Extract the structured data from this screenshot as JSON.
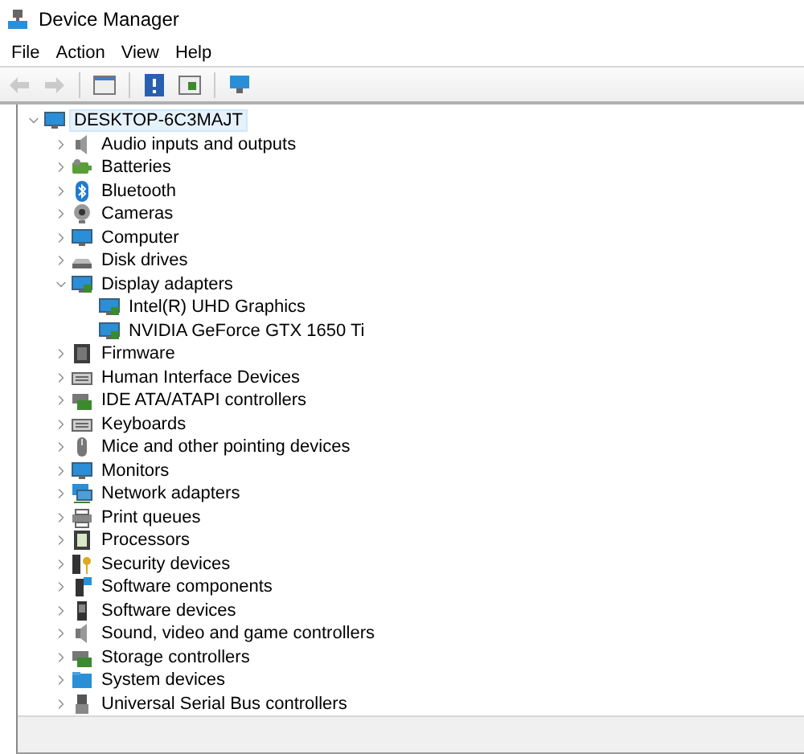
{
  "window": {
    "title": "Device Manager"
  },
  "menu": [
    {
      "label": "File"
    },
    {
      "label": "Action"
    },
    {
      "label": "View"
    },
    {
      "label": "Help"
    }
  ],
  "toolbar": [
    {
      "disabled": true
    },
    {
      "disabled": true
    },
    {
      "disabled": false
    },
    {
      "disabled": false
    },
    {
      "disabled": false
    },
    {
      "disabled": false
    }
  ],
  "tree": {
    "label": "DESKTOP-6C3MAJT",
    "expanded": true,
    "selected": true,
    "children": [
      {
        "label": "Audio inputs and outputs",
        "expanded": false,
        "selected": false
      },
      {
        "label": "Batteries",
        "expanded": false,
        "selected": false
      },
      {
        "label": "Bluetooth",
        "expanded": false,
        "selected": false
      },
      {
        "label": "Cameras",
        "expanded": false,
        "selected": false
      },
      {
        "label": "Computer",
        "expanded": false,
        "selected": false
      },
      {
        "label": "Disk drives",
        "expanded": false,
        "selected": false
      },
      {
        "label": "Display adapters",
        "expanded": true,
        "selected": false,
        "children": [
          {
            "label": "Intel(R) UHD Graphics",
            "selected": false
          },
          {
            "label": "NVIDIA GeForce GTX 1650 Ti",
            "selected": false
          }
        ]
      },
      {
        "label": "Firmware",
        "expanded": false,
        "selected": false
      },
      {
        "label": "Human Interface Devices",
        "expanded": false,
        "selected": false
      },
      {
        "label": "IDE ATA/ATAPI controllers",
        "expanded": false,
        "selected": false
      },
      {
        "label": "Keyboards",
        "expanded": false,
        "selected": false
      },
      {
        "label": "Mice and other pointing devices",
        "expanded": false,
        "selected": false
      },
      {
        "label": "Monitors",
        "expanded": false,
        "selected": false
      },
      {
        "label": "Network adapters",
        "expanded": false,
        "selected": false
      },
      {
        "label": "Print queues",
        "expanded": false,
        "selected": false
      },
      {
        "label": "Processors",
        "expanded": false,
        "selected": false
      },
      {
        "label": "Security devices",
        "expanded": false,
        "selected": false
      },
      {
        "label": "Software components",
        "expanded": false,
        "selected": false
      },
      {
        "label": "Software devices",
        "expanded": false,
        "selected": false
      },
      {
        "label": "Sound, video and game controllers",
        "expanded": false,
        "selected": false
      },
      {
        "label": "Storage controllers",
        "expanded": false,
        "selected": false
      },
      {
        "label": "System devices",
        "expanded": false,
        "selected": false
      },
      {
        "label": "Universal Serial Bus controllers",
        "expanded": false,
        "selected": false
      }
    ]
  }
}
